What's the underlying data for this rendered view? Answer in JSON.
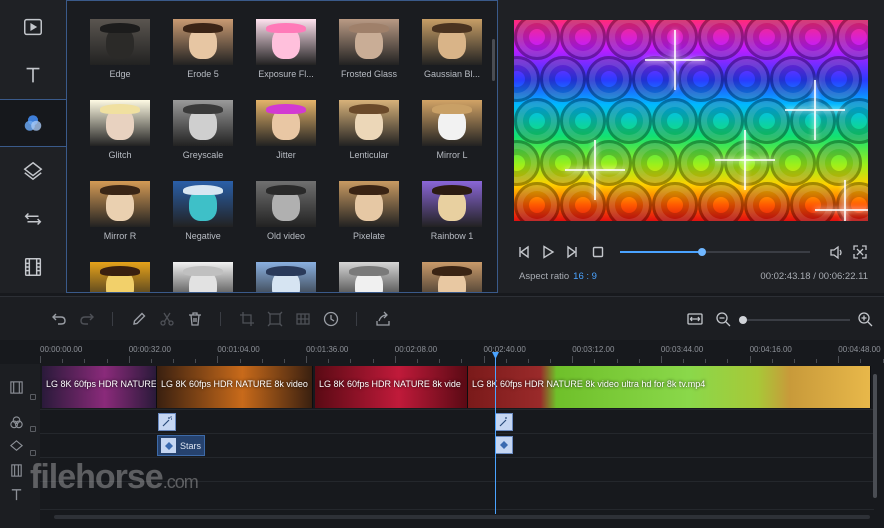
{
  "sidebar": {
    "items": [
      {
        "id": "media",
        "icon": "media-play-icon",
        "active": false
      },
      {
        "id": "text",
        "icon": "text-icon",
        "active": false
      },
      {
        "id": "filters",
        "icon": "filters-icon",
        "active": true
      },
      {
        "id": "overlays",
        "icon": "overlay-layers-icon",
        "active": false
      },
      {
        "id": "transitions",
        "icon": "transition-arrows-icon",
        "active": false
      },
      {
        "id": "elements",
        "icon": "film-strip-icon",
        "active": false
      }
    ]
  },
  "effects": {
    "items": [
      {
        "label": "Edge",
        "tone": "#5a5550",
        "dog": "#2b2a28",
        "hat": "#1c1c1c"
      },
      {
        "label": "Erode 5",
        "tone": "#c99a72",
        "dog": "#e7c6a3",
        "hat": "#3b2416"
      },
      {
        "label": "Exposure Fl...",
        "tone": "#ffe2ef",
        "dog": "#ffc0dc",
        "hat": "#ff7ab8"
      },
      {
        "label": "Frosted Glass",
        "tone": "#b99a84",
        "dog": "#c9ad96",
        "hat": "#9f806a"
      },
      {
        "label": "Gaussian Bl...",
        "tone": "#c79e66",
        "dog": "#d9b488",
        "hat": "#4a3320"
      },
      {
        "label": "Glitch",
        "tone": "#fffbe4",
        "dog": "#e8d2c0",
        "hat": "#f0e0a0"
      },
      {
        "label": "Greyscale",
        "tone": "#9a9a9a",
        "dog": "#cfcfcf",
        "hat": "#3a3a3a"
      },
      {
        "label": "Jitter",
        "tone": "#e4b36a",
        "dog": "#e9c7a4",
        "hat": "#d23ad2"
      },
      {
        "label": "Lenticular",
        "tone": "#d8b27a",
        "dog": "#ecd7b8",
        "hat": "#6b4a2a"
      },
      {
        "label": "Mirror L",
        "tone": "#d2a366",
        "dog": "#f2f2f2",
        "hat": "#c9a066"
      },
      {
        "label": "Mirror R",
        "tone": "#d49a55",
        "dog": "#ead0b0",
        "hat": "#3a2616"
      },
      {
        "label": "Negative",
        "tone": "#2a5fa8",
        "dog": "#3ec0c8",
        "hat": "#d8e6f2"
      },
      {
        "label": "Old video",
        "tone": "#707070",
        "dog": "#b0b0b0",
        "hat": "#2a2a2a"
      },
      {
        "label": "Pixelate",
        "tone": "#c89a62",
        "dog": "#e6c8a4",
        "hat": "#3a2414"
      },
      {
        "label": "Rainbow 1",
        "tone": "#8a66d8",
        "dog": "#e8d0a0",
        "hat": "#2c1c12"
      },
      {
        "label": "",
        "tone": "#e6a21a",
        "dog": "#f2d06a",
        "hat": "#3a2010"
      },
      {
        "label": "",
        "tone": "#f2f2f2",
        "dog": "#e2e2e2",
        "hat": "#c0c0c0"
      },
      {
        "label": "",
        "tone": "#8ab0e0",
        "dog": "#d6e4f2",
        "hat": "#2a3a5a"
      },
      {
        "label": "",
        "tone": "#d6d6d6",
        "dog": "#f0f0f0",
        "hat": "#7a7a7a"
      },
      {
        "label": "",
        "tone": "#c99a6a",
        "dog": "#e8c8a2",
        "hat": "#3a2414"
      }
    ]
  },
  "preview": {
    "aspect_label": "Aspect ratio",
    "aspect_value": "16 : 9",
    "timecode": "00:02:43.18 / 00:06:22.11",
    "progress": 0.43
  },
  "timeline": {
    "ticks": [
      "00:00:00.00",
      "00:00:32.00",
      "00:01:04.00",
      "00:01:36.00",
      "00:02:08.00",
      "00:02:40.00",
      "00:03:12.00",
      "00:03:44.00",
      "00:04:16.00",
      "00:04:48.00"
    ],
    "clips": [
      {
        "label": "LG 8K 60fps HDR NATURE",
        "color": "#2a1a3a",
        "accent": "#8a2a7a"
      },
      {
        "label": "LG 8K 60fps HDR NATURE 8k video",
        "color": "#3a2010",
        "accent": "#c86a1a"
      },
      {
        "label": "LG 8K 60fps HDR NATURE 8k vide",
        "color": "#5a0a14",
        "accent": "#c01a3a"
      },
      {
        "label": "LG 8K 60fps HDR NATURE 8k video ultra hd for 8k tv.mp4",
        "color": "#7a1a1a",
        "accent": "#6fc02a"
      }
    ],
    "overlay_label": "Stars",
    "zoom": 0.05
  },
  "watermark": {
    "brand": "filehorse",
    "suffix": ".com"
  }
}
